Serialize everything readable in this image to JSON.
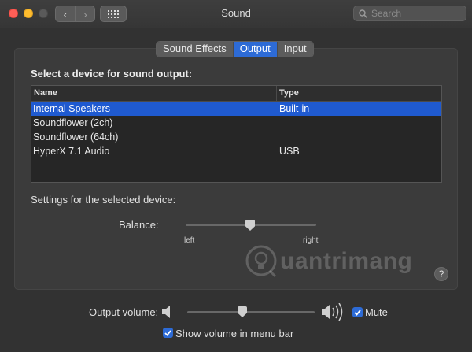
{
  "window": {
    "title": "Sound",
    "search_placeholder": "Search"
  },
  "tabs": [
    {
      "label": "Sound Effects",
      "active": false
    },
    {
      "label": "Output",
      "active": true
    },
    {
      "label": "Input",
      "active": false
    }
  ],
  "output": {
    "heading": "Select a device for sound output:",
    "columns": {
      "name": "Name",
      "type": "Type"
    },
    "devices": [
      {
        "name": "Internal Speakers",
        "type": "Built-in",
        "selected": true
      },
      {
        "name": "Soundflower (2ch)",
        "type": "",
        "selected": false
      },
      {
        "name": "Soundflower (64ch)",
        "type": "",
        "selected": false
      },
      {
        "name": "HyperX 7.1 Audio",
        "type": "USB",
        "selected": false
      }
    ],
    "settings_label": "Settings for the selected device:",
    "balance": {
      "label": "Balance:",
      "left_label": "left",
      "right_label": "right",
      "value": 0.5
    }
  },
  "watermark": {
    "text": "uantrimang"
  },
  "help": {
    "label": "?"
  },
  "volume": {
    "label": "Output volume:",
    "value": 0.4,
    "mute_label": "Mute",
    "mute_checked": true,
    "show_in_menubar_label": "Show volume in menu bar",
    "show_in_menubar_checked": true
  },
  "colors": {
    "accent": "#2d6bd6",
    "selection": "#1f5ad0",
    "background": "#323232"
  }
}
